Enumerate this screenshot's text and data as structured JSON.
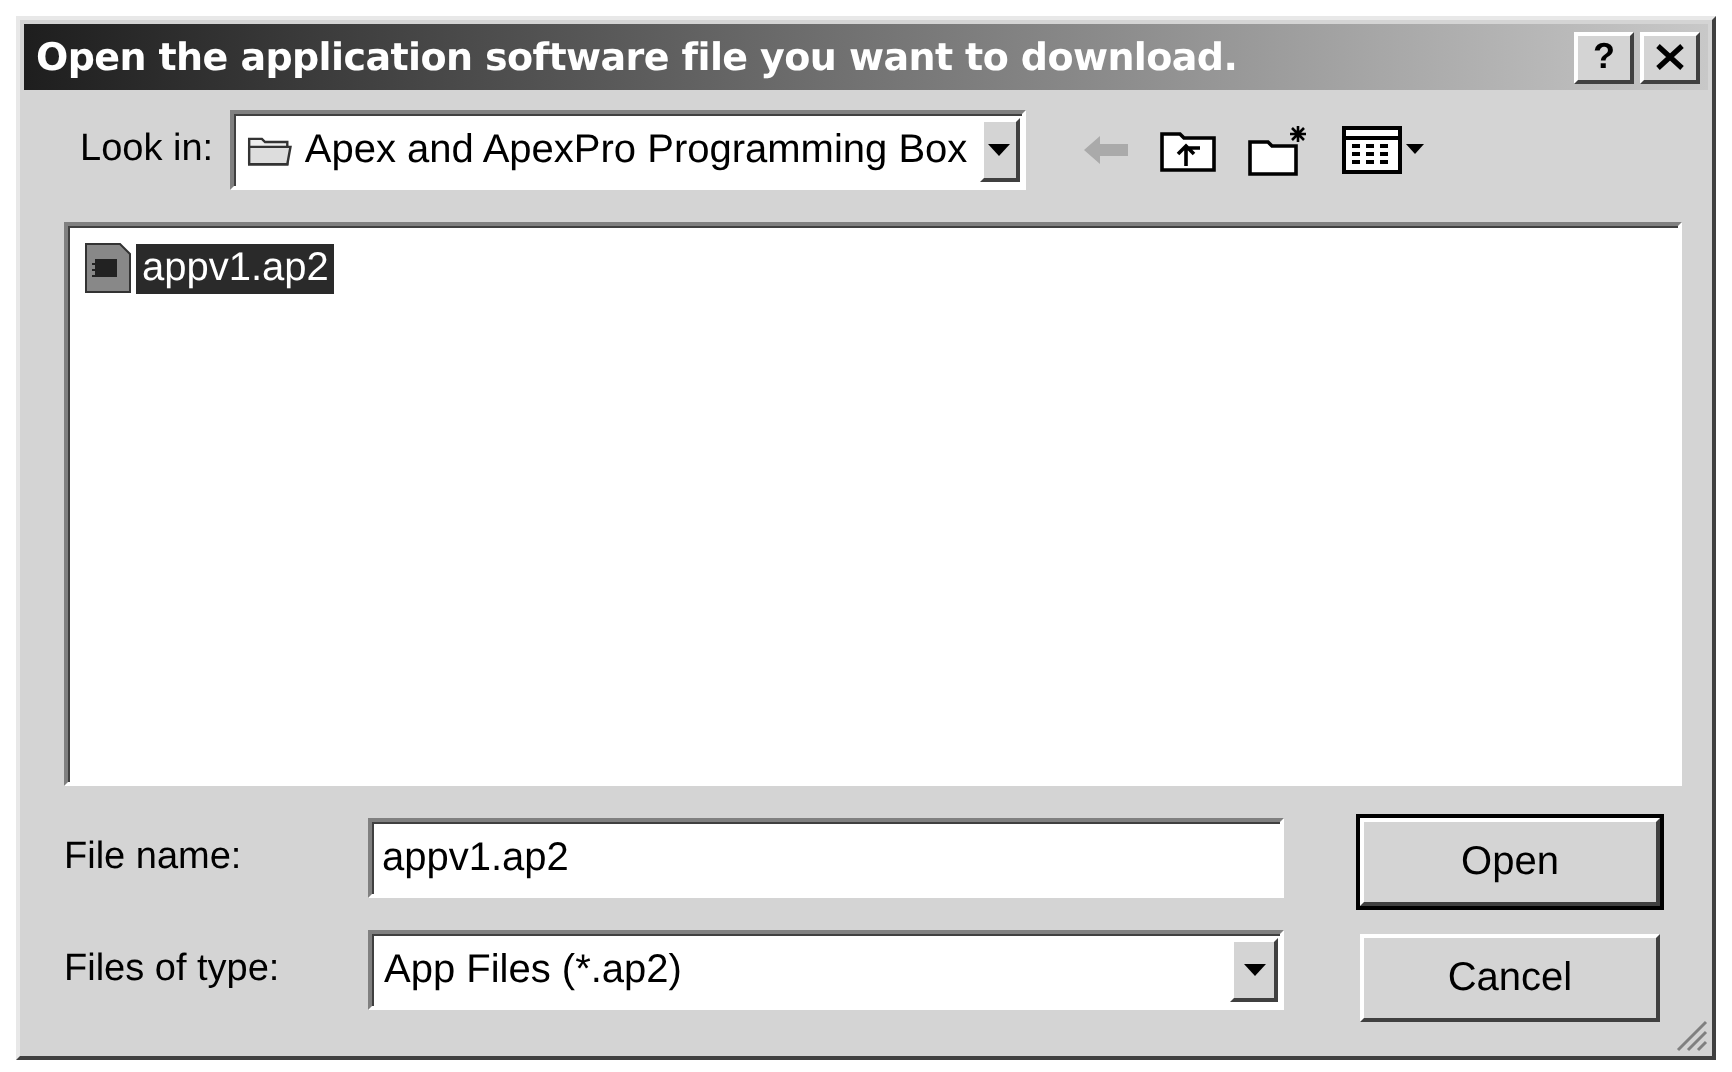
{
  "window": {
    "title": "Open the application software file you want to download.",
    "help_button": "?"
  },
  "look_in": {
    "label": "Look in:",
    "value": "Apex and ApexPro Programming Box"
  },
  "files": [
    {
      "name": "appv1.ap2",
      "selected": true
    }
  ],
  "file_name": {
    "label": "File name:",
    "value": "appv1.ap2"
  },
  "file_type": {
    "label": "Files of type:",
    "value": "App Files (*.ap2)"
  },
  "buttons": [
    {
      "label": "Open",
      "default": true
    },
    {
      "label": "Cancel",
      "default": false
    }
  ]
}
